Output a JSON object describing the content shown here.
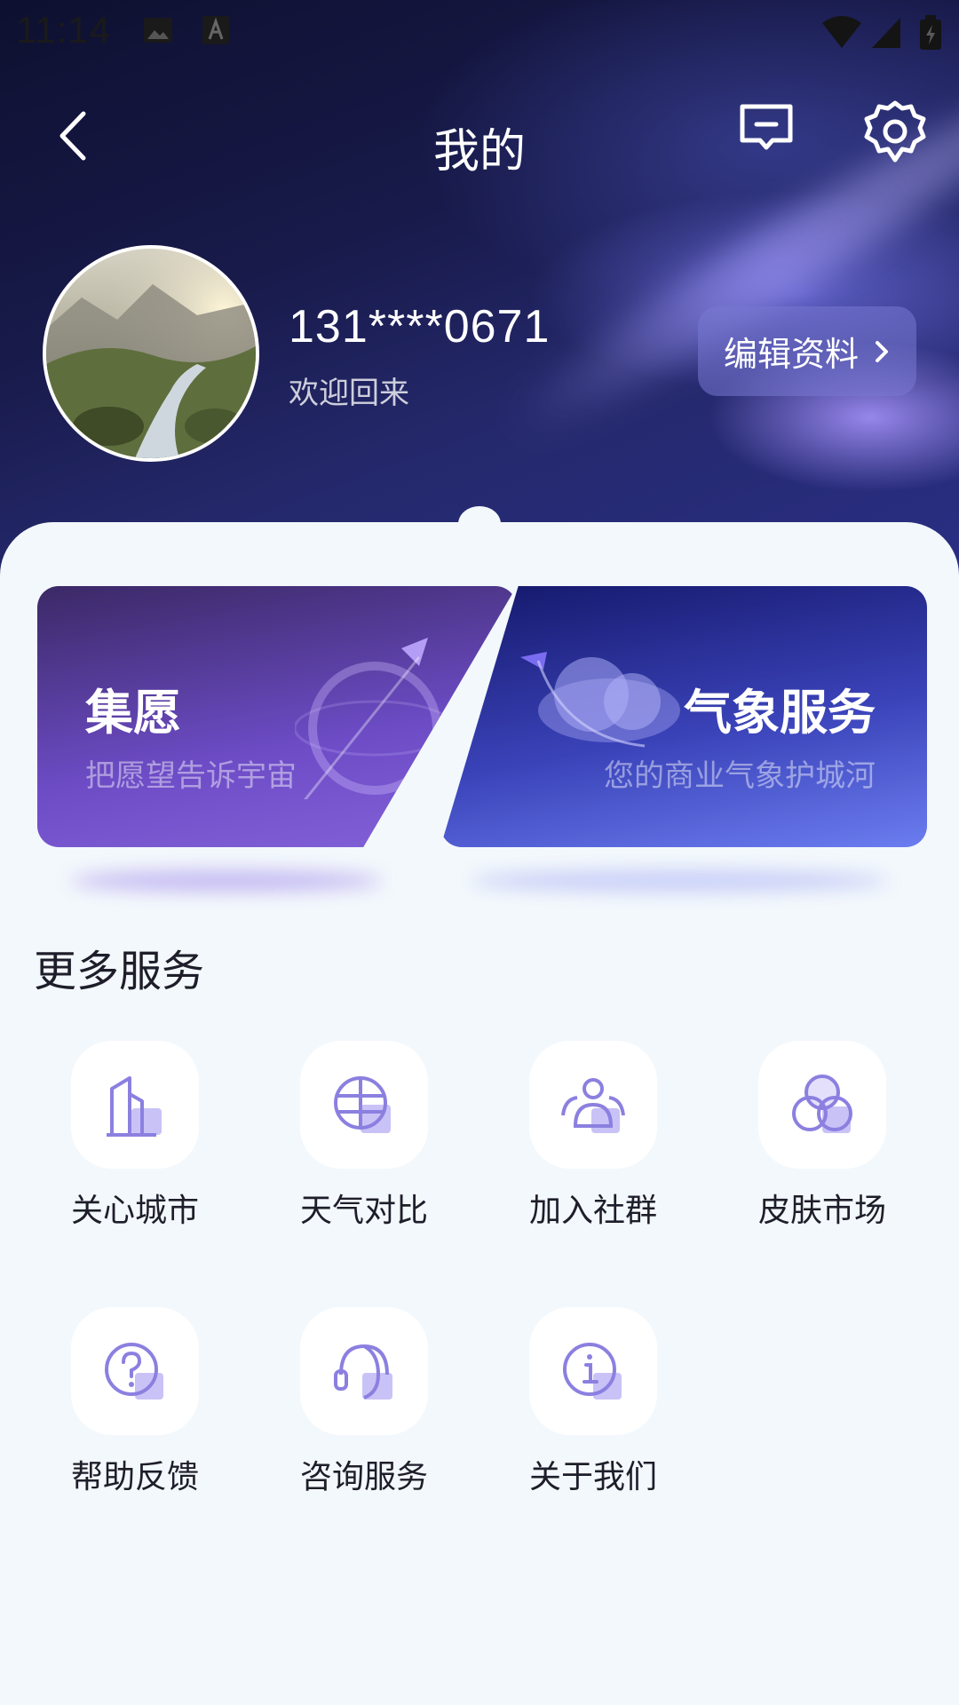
{
  "status_bar": {
    "time": "11:14"
  },
  "header": {
    "title": "我的"
  },
  "profile": {
    "username": "131****0671",
    "welcome": "欢迎回来",
    "edit_label": "编辑资料"
  },
  "cards": [
    {
      "title": "集愿",
      "subtitle": "把愿望告诉宇宙"
    },
    {
      "title": "气象服务",
      "subtitle": "您的商业气象护城河"
    }
  ],
  "more_services": {
    "title": "更多服务",
    "items": [
      {
        "label": "关心城市",
        "icon": "building-icon"
      },
      {
        "label": "天气对比",
        "icon": "globe-compare-icon"
      },
      {
        "label": "加入社群",
        "icon": "community-icon"
      },
      {
        "label": "皮肤市场",
        "icon": "skin-circles-icon"
      },
      {
        "label": "帮助反馈",
        "icon": "question-icon"
      },
      {
        "label": "咨询服务",
        "icon": "headset-icon"
      },
      {
        "label": "关于我们",
        "icon": "info-icon"
      }
    ]
  },
  "colors": {
    "accent": "#6d5fe0",
    "icon_fill": "#c9c2f6",
    "icon_stroke": "#8b80e0"
  }
}
